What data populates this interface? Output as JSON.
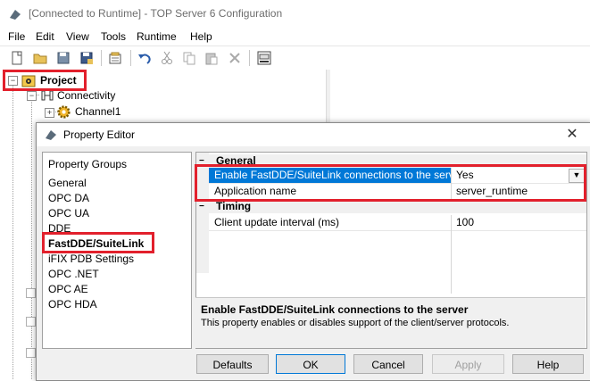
{
  "window": {
    "title": "[Connected to Runtime] - TOP Server 6 Configuration"
  },
  "menu": [
    "File",
    "Edit",
    "View",
    "Tools",
    "Runtime",
    "Help"
  ],
  "toolbar": {
    "icons": [
      "new-icon",
      "open-icon",
      "save-icon",
      "save-as-icon",
      "properties-icon",
      "undo-icon",
      "cut-icon",
      "copy-icon",
      "paste-icon",
      "delete-icon",
      "quick-client-icon"
    ]
  },
  "tree": {
    "project": "Project",
    "connectivity": "Connectivity",
    "channel1": "Channel1"
  },
  "dialog": {
    "title": "Property Editor",
    "groups_header": "Property Groups",
    "groups": [
      "General",
      "OPC DA",
      "OPC UA",
      "DDE",
      "FastDDE/SuiteLink",
      "iFIX PDB Settings",
      "OPC .NET",
      "OPC AE",
      "OPC HDA"
    ],
    "selected_group": "FastDDE/SuiteLink",
    "categories": {
      "general": "General",
      "timing": "Timing"
    },
    "properties": {
      "enable_name": "Enable FastDDE/SuiteLink connections to the server",
      "enable_value": "Yes",
      "app_name": "Application name",
      "app_value": "server_runtime",
      "client_interval_name": "Client update interval (ms)",
      "client_interval_value": "100"
    },
    "description": {
      "title": "Enable FastDDE/SuiteLink connections to the server",
      "text": "This property enables or disables support of the client/server protocols."
    },
    "buttons": {
      "defaults": "Defaults",
      "ok": "OK",
      "cancel": "Cancel",
      "apply": "Apply",
      "help": "Help"
    }
  },
  "colors": {
    "highlight": "#e2202c",
    "selection": "#0078d7"
  }
}
